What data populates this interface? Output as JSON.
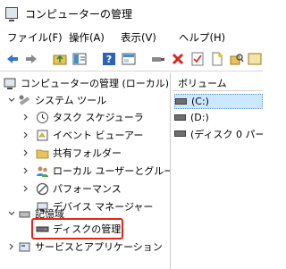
{
  "window": {
    "title": "コンピューターの管理"
  },
  "menu": [
    "ファイル(F)",
    "操作(A)",
    "表示(V)",
    "ヘルプ(H)"
  ],
  "toolbar": {
    "buttons": [
      "back-arrow-icon",
      "forward-arrow-icon",
      "up-folder-icon",
      "show-hide-tree-icon",
      "help-icon",
      "properties-icon",
      "connect-icon",
      "delete-icon",
      "check-icon",
      "new-icon",
      "search-icon",
      "disk-icon"
    ]
  },
  "tree": {
    "root": "コンピューターの管理 (ローカル)",
    "system_tools": "システム ツール",
    "items": [
      "タスク スケジューラ",
      "イベント ビューアー",
      "共有フォルダー",
      "ローカル ユーザーとグループ",
      "パフォーマンス",
      "デバイス マネージャー"
    ],
    "storage": "記憶域",
    "disk_management": "ディスクの管理",
    "services": "サービスとアプリケーション"
  },
  "list": {
    "column_header": "ボリューム",
    "volumes": [
      "(C:)",
      "(D:)",
      "(ディスク 0 パーテ"
    ]
  },
  "colors": {
    "selection": "#cce8ff",
    "highlight_border": "#e0271b"
  }
}
